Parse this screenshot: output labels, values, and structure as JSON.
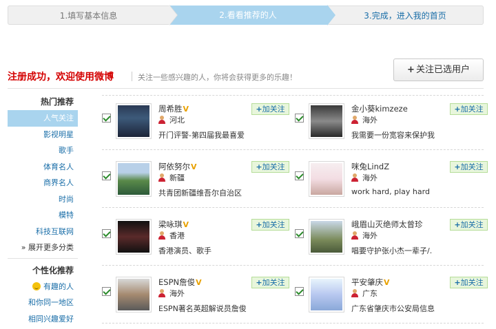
{
  "steps": [
    {
      "label": "1.填写基本信息"
    },
    {
      "label": "2.看看推荐的人"
    },
    {
      "label": "3.完成，进入我的首页"
    }
  ],
  "header": {
    "success": "注册成功，欢迎使用微博",
    "subtitle": "关注一些感兴趣的人，你将会获得更多的乐趣！",
    "follow_selected": "关注已选用户"
  },
  "sidebar": {
    "hot_title": "热门推荐",
    "hot_items": [
      "人气关注",
      "影视明星",
      "歌手",
      "体育名人",
      "商界名人",
      "时尚",
      "模特",
      "科技互联网"
    ],
    "more": "展开更多分类",
    "personal_title": "个性化推荐",
    "personal_items": [
      "有趣的人",
      "和你同一地区",
      "相同兴趣爱好"
    ]
  },
  "add_label": "加关注",
  "users": [
    {
      "name": "周希胜",
      "verified": true,
      "location": "河北",
      "desc": "开门评警-第四届我最喜爱"
    },
    {
      "name": "金小葵kimzeze",
      "verified": false,
      "location": "海外",
      "desc": "我需要一份宽容来保护我"
    },
    {
      "name": "阿依努尔",
      "verified": true,
      "location": "新疆",
      "desc": "共青团新疆维吾尔自治区"
    },
    {
      "name": "咪兔LindZ",
      "verified": false,
      "location": "海外",
      "desc": "work hard, play hard"
    },
    {
      "name": "梁咏琪",
      "verified": true,
      "location": "香港",
      "desc": "香港演员、歌手"
    },
    {
      "name": "峨眉山灭绝师太曾珍",
      "verified": false,
      "location": "海外",
      "desc": "唱要守护张小杰一辈子/."
    },
    {
      "name": "ESPN詹俊",
      "verified": true,
      "location": "海外",
      "desc": "ESPN著名英超解说员詹俊"
    },
    {
      "name": "平安肇庆",
      "verified": true,
      "location": "广东",
      "desc": "广东省肇庆市公安局信息"
    }
  ],
  "colors": {
    "accent": "#a9d4ee",
    "link": "#1a6ea8",
    "success": "#d40000",
    "add_bg": "#e8f6dc"
  }
}
